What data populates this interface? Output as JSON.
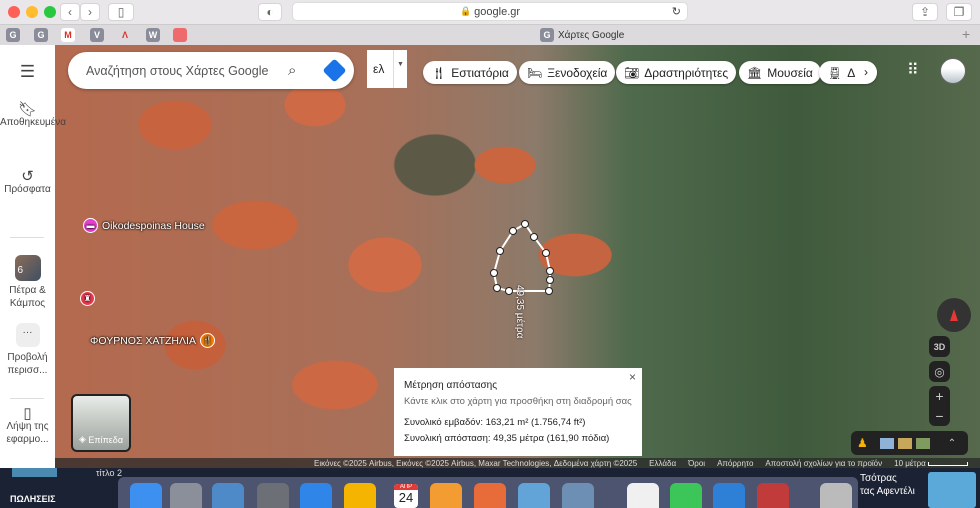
{
  "browser": {
    "url": "google.gr",
    "active_tab": "Χάρτες Google",
    "favicons": [
      "G",
      "G",
      "M",
      "V",
      "Λ",
      "W",
      ""
    ]
  },
  "sidebar": {
    "items": [
      {
        "label": "Αποθηκευμένα"
      },
      {
        "label": "Πρόσφατα"
      },
      {
        "label": "Πέτρα & Κάμπος",
        "badge": "6"
      },
      {
        "label": "Προβολή περισσ..."
      },
      {
        "label": "Λήψη της εφαρμο..."
      }
    ]
  },
  "search": {
    "placeholder": "Αναζήτηση στους Χάρτες Google"
  },
  "language": {
    "value": "ελ"
  },
  "chips": [
    {
      "label": "Εστιατόρια"
    },
    {
      "label": "Ξενοδοχεία"
    },
    {
      "label": "Δραστηριότητες"
    },
    {
      "label": "Μουσεία"
    },
    {
      "label": "Δι"
    }
  ],
  "pois": [
    {
      "label": "Oikodespoinas House"
    },
    {
      "label": ""
    },
    {
      "label": "ΦΟΥΡΝΟΣ ΧΑΤΖΗΛΙΑ"
    }
  ],
  "map": {
    "measure_label": "49,35 μέτρα",
    "layers_label": "Επίπεδα",
    "btn_3d": "3D"
  },
  "measure_panel": {
    "title": "Μέτρηση απόστασης",
    "hint": "Κάντε κλικ στο χάρτη για προσθήκη στη διαδρομή σας",
    "area": "Συνολικό εμβαδόν: 163,21 m² (1.756,74 ft²)",
    "distance": "Συνολική απόσταση: 49,35 μέτρα (161,90 πόδια)"
  },
  "attribution": {
    "imagery": "Εικόνες ©2025 Airbus, Εικόνες ©2025 Airbus, Maxar Technologies, Δεδομένα χάρτη ©2025",
    "country": "Ελλάδα",
    "terms": "Όροι",
    "privacy": "Απόρρητο",
    "feedback": "Αποστολή σχολίων για το προϊόν",
    "scale": "10 μέτρα"
  },
  "desktop": {
    "label_title": "τίτλο 2",
    "label_sales": "ΠΩΛΗΣΕΙΣ",
    "notification_line1": "Τσότρας",
    "notification_line2": "τας Αφεντέλι",
    "calendar_month": "ΑΠΡ",
    "calendar_day": "24"
  },
  "colors": {
    "accent": "#1a73e8",
    "hotel_pin": "#e53fd0",
    "food_pin": "#f57c00",
    "shop_pin": "#e8384f"
  }
}
